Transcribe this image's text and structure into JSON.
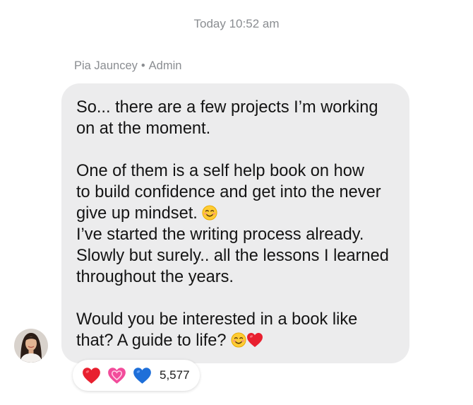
{
  "timestamp": "Today 10:52 am",
  "sender": {
    "name": "Pia Jauncey",
    "separator": "•",
    "role": "Admin"
  },
  "message": {
    "p1": "So... there are a few projects I’m working\non at the moment.",
    "p2_text": "One of them is a self help book on how\nto build confidence and get into the never\ngive up mindset. ",
    "p2_emoji": "smiling-face-with-smiling-eyes",
    "p3": "I’ve started the writing process already.\nSlowly but surely.. all the lessons I learned\nthroughout the years.",
    "p4_text": "Would you be interested in a book like\nthat? A guide to life? ",
    "p4_emojis": [
      "smiling-face-with-smiling-eyes",
      "red-heart"
    ]
  },
  "reactions": {
    "icons": [
      "red-heart",
      "pink-growing-heart",
      "blue-heart"
    ],
    "count": "5,577"
  },
  "colors": {
    "bubble": "#ececed",
    "meta_text": "#8a8d91",
    "red_heart": "#e8202f",
    "pink_heart": "#f24c9b",
    "blue_heart": "#1e6fd9"
  }
}
